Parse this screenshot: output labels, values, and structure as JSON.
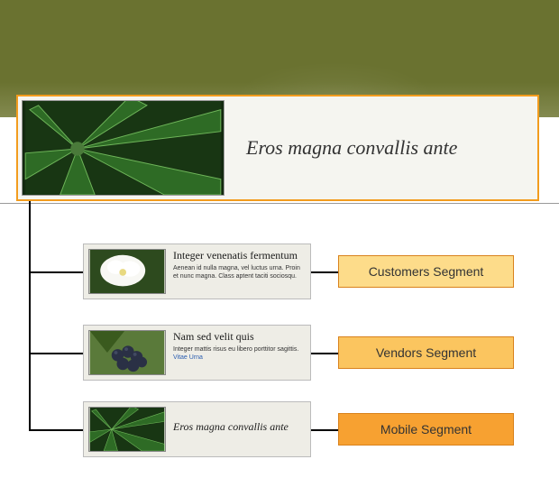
{
  "hero": {
    "title": "Eros magna convallis ante"
  },
  "cards": [
    {
      "title": "Integer venenatis fermentum",
      "desc": "Aenean id nulla magna, vel luctus urna. Proin et nunc magna. Class aptent taciti sociosqu."
    },
    {
      "title": "Nam sed velit quis",
      "desc": "Integer mattis risus eu libero porttitor sagittis. ",
      "link": "Vitae Urna"
    },
    {
      "title": "Eros magna convallis ante"
    }
  ],
  "segments": [
    {
      "label": "Customers Segment"
    },
    {
      "label": "Vendors Segment"
    },
    {
      "label": "Mobile Segment"
    }
  ]
}
